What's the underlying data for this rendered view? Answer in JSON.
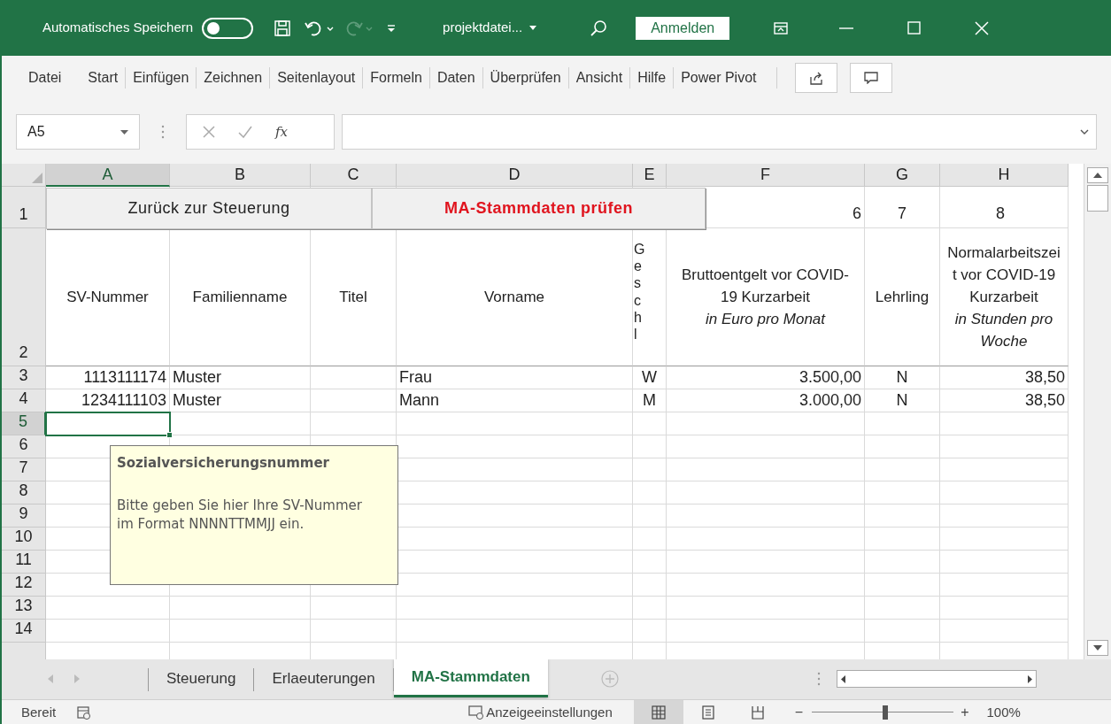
{
  "title_bar": {
    "autosave_label": "Automatisches Speichern",
    "autosave_on": false,
    "filename": "projektdatei...",
    "sign_in": "Anmelden"
  },
  "menu": [
    "Datei",
    "Start",
    "Einfügen",
    "Zeichnen",
    "Seitenlayout",
    "Formeln",
    "Daten",
    "Überprüfen",
    "Ansicht",
    "Hilfe",
    "Power Pivot"
  ],
  "formula_bar": {
    "name_box": "A5",
    "fx": "fx"
  },
  "sheet": {
    "columns": [
      {
        "label": "A",
        "selected": true
      },
      {
        "label": "B",
        "selected": false
      },
      {
        "label": "C",
        "selected": false
      },
      {
        "label": "D",
        "selected": false
      },
      {
        "label": "E",
        "selected": false
      },
      {
        "label": "F",
        "selected": false
      },
      {
        "label": "G",
        "selected": false
      },
      {
        "label": "H",
        "selected": false
      }
    ],
    "rows": [
      {
        "label": "1",
        "selected": false
      },
      {
        "label": "2",
        "selected": false
      },
      {
        "label": "3",
        "selected": false
      },
      {
        "label": "4",
        "selected": false
      },
      {
        "label": "5",
        "selected": true
      },
      {
        "label": "6",
        "selected": false
      },
      {
        "label": "7",
        "selected": false
      },
      {
        "label": "8",
        "selected": false
      },
      {
        "label": "9",
        "selected": false
      },
      {
        "label": "10",
        "selected": false
      },
      {
        "label": "11",
        "selected": false
      },
      {
        "label": "12",
        "selected": false
      },
      {
        "label": "13",
        "selected": false
      },
      {
        "label": "14",
        "selected": false
      }
    ],
    "sheet_buttons": [
      {
        "label": "Zurück zur Steuerung",
        "kind": "plain"
      },
      {
        "label": "MA-Stammdaten prüfen",
        "kind": "highlight"
      }
    ],
    "row1": {
      "F": "6",
      "G": "7",
      "H": "8"
    },
    "headers": [
      {
        "title": "SV-Nummer"
      },
      {
        "title": "Familienname"
      },
      {
        "title": "Titel"
      },
      {
        "title": "Vorname"
      },
      {
        "title": "Geschl",
        "kind": "stacked"
      },
      {
        "title": "Bruttoentgelt vor COVID-19 Kurzarbeit",
        "unit": "in Euro pro Monat"
      },
      {
        "title": "Lehrling"
      },
      {
        "title": "Normalarbeitszeit vor COVID-19 Kurzarbeit",
        "unit": "in Stunden pro Woche"
      }
    ],
    "data": [
      {
        "A": "1113111174",
        "B": "Muster",
        "D": "Frau",
        "E": "W",
        "F": "3.500,00",
        "G": "N",
        "H": "38,50"
      },
      {
        "A": "1234111103",
        "B": "Muster",
        "D": "Mann",
        "E": "M",
        "F": "3.000,00",
        "G": "N",
        "H": "38,50"
      }
    ],
    "tooltip": {
      "title": "Sozialversicherungsnummer",
      "body": "Bitte geben Sie hier Ihre SV-Nummer im Format NNNNTTMMJJ ein."
    }
  },
  "sheet_tabs": [
    {
      "label": "Steuerung",
      "selected": false
    },
    {
      "label": "Erlaeuterungen",
      "selected": false
    },
    {
      "label": "MA-Stammdaten",
      "selected": true
    }
  ],
  "status_bar": {
    "status": "Bereit",
    "display_settings": "Anzeigeeinstellungen",
    "views": [
      {
        "kind": "normal",
        "selected": true
      },
      {
        "kind": "page_layout",
        "selected": false
      },
      {
        "kind": "page_break",
        "selected": false
      }
    ],
    "zoom_minus": "−",
    "zoom_plus": "+",
    "zoom": {
      "level": 0.52
    },
    "zoom_label": "100%"
  }
}
